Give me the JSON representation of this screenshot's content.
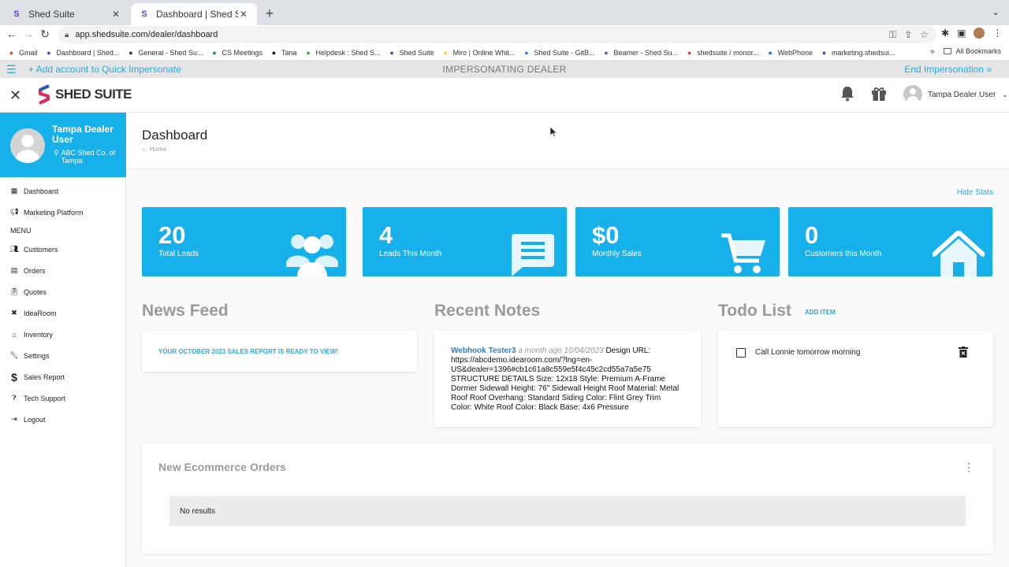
{
  "browser": {
    "tabs": [
      {
        "title": "Shed Suite",
        "active": false
      },
      {
        "title": "Dashboard | Shed Suite",
        "active": true
      }
    ],
    "url": "app.shedsuite.com/dealer/dashboard",
    "bookmarks": [
      {
        "label": "Gmail",
        "icon": "gmail-icon",
        "color": "#ea4335"
      },
      {
        "label": "Dashboard | Shed...",
        "icon": "shedsuite-icon",
        "color": "#5b3fc4"
      },
      {
        "label": "General - Shed Su...",
        "icon": "clickup-icon",
        "color": "#333333"
      },
      {
        "label": "CS Meetings",
        "icon": "meet-icon",
        "color": "#0f9d58"
      },
      {
        "label": "Tana",
        "icon": "tana-icon",
        "color": "#111111"
      },
      {
        "label": "Helpdesk : Shed S...",
        "icon": "helpdesk-icon",
        "color": "#34a853"
      },
      {
        "label": "Shed Suite",
        "icon": "shedsuite-icon",
        "color": "#5b3fc4"
      },
      {
        "label": "Miro | Online Whit...",
        "icon": "miro-icon",
        "color": "#ffd02f"
      },
      {
        "label": "Shed Suite - GitB...",
        "icon": "gitbook-icon",
        "color": "#3884ff"
      },
      {
        "label": "Beamer - Shed Su...",
        "icon": "beamer-icon",
        "color": "#5b5fc7"
      },
      {
        "label": "shedsuite / monor...",
        "icon": "gitlab-icon",
        "color": "#e24329"
      },
      {
        "label": "WebPhone",
        "icon": "webphone-icon",
        "color": "#1a73e8"
      },
      {
        "label": "marketing.shedsui...",
        "icon": "shedsuite-icon",
        "color": "#5b3fc4"
      }
    ],
    "all_bookmarks": "All Bookmarks"
  },
  "impersonation": {
    "add_label": "+ Add account to Quick Impersonate",
    "status": "IMPERSONATING DEALER",
    "end_label": "End Impersonation »"
  },
  "header": {
    "logo_text": "SHED SUITE",
    "user_name": "Tampa Dealer User"
  },
  "sidebar": {
    "profile_name": "Tampa Dealer User",
    "profile_company": "ABC Shed Co. of Tampa",
    "top_items": [
      {
        "label": "Dashboard",
        "icon": "dashboard-icon"
      },
      {
        "label": "Marketing Platform",
        "icon": "megaphone-icon"
      }
    ],
    "menu_heading": "MENU",
    "items": [
      {
        "label": "Customers",
        "icon": "people-icon"
      },
      {
        "label": "Orders",
        "icon": "document-icon"
      },
      {
        "label": "Quotes",
        "icon": "clipboard-icon"
      },
      {
        "label": "IdeaRoom",
        "icon": "tools-icon"
      },
      {
        "label": "Inventory",
        "icon": "home-icon"
      },
      {
        "label": "Settings",
        "icon": "wrench-icon"
      },
      {
        "label": "Sales Report",
        "icon": "dollar-icon"
      },
      {
        "label": "Tech Support",
        "icon": "help-icon"
      },
      {
        "label": "Logout",
        "icon": "logout-icon"
      }
    ]
  },
  "page": {
    "title": "Dashboard",
    "breadcrumb": "Home",
    "hide_stats": "Hide Stats"
  },
  "stats": [
    {
      "value": "20",
      "label": "Total Leads",
      "icon": "users-icon"
    },
    {
      "value": "4",
      "label": "Leads This Month",
      "icon": "chat-icon"
    },
    {
      "value": "$0",
      "label": "Monthly Sales",
      "icon": "cart-icon"
    },
    {
      "value": "0",
      "label": "Customers this Month",
      "icon": "house-icon"
    }
  ],
  "news_feed": {
    "title": "News Feed",
    "item": "YOUR OCTOBER 2023 SALES REPORT IS READY TO VIEW!"
  },
  "recent_notes": {
    "title": "Recent Notes",
    "author": "Webhook Tester3",
    "meta": "a month ago 10/04/2023",
    "body": "Design URL: https://abcdemo.idearoom.com/?lng=en-US&dealer=1396#cb1c61a8c559e5f4c45c2cd55a7a5e75 STRUCTURE DETAILS Size: 12x18 Style: Premium A-Frame Dormer Sidewall Height: 76\" Sidewall Height Roof Material: Metal Roof Roof Overhang: Standard Siding Color: Flint Grey Trim Color: White Roof Color: Black Base: 4x6 Pressure"
  },
  "todo": {
    "title": "Todo List",
    "add_label": "ADD ITEM",
    "items": [
      {
        "text": "Call Lonnie tomorrow morning",
        "checked": false
      }
    ]
  },
  "ecommerce": {
    "title": "New Ecommerce Orders",
    "empty": "No results"
  },
  "colors": {
    "accent": "#16b0ea",
    "link": "#2aa8e0",
    "section_title": "#9a9a9a"
  }
}
